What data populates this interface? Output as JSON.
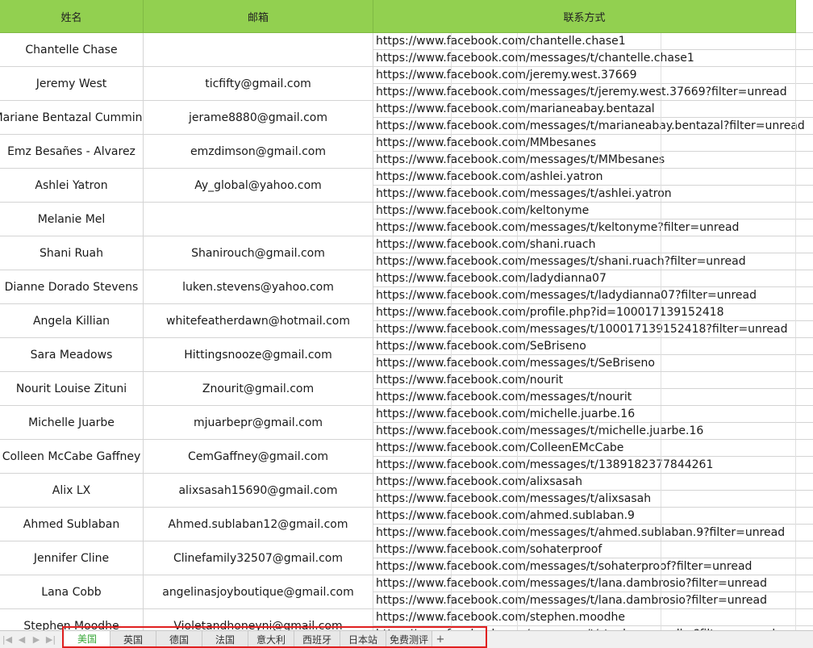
{
  "headers": {
    "name": "姓名",
    "email": "邮箱",
    "contact": "联系方式"
  },
  "rows": [
    {
      "name": "Chantelle Chase",
      "email": "",
      "link1": "https://www.facebook.com/chantelle.chase1",
      "link2": "https://www.facebook.com/messages/t/chantelle.chase1"
    },
    {
      "name": "Jeremy West",
      "email": "ticfifty@gmail.com",
      "link1": "https://www.facebook.com/jeremy.west.37669",
      "link2": "https://www.facebook.com/messages/t/jeremy.west.37669?filter=unread"
    },
    {
      "name": "Mariane Bentazal Cumming",
      "email": "jerame8880@gmail.com",
      "link1": "https://www.facebook.com/marianeabay.bentazal",
      "link2": "https://www.facebook.com/messages/t/marianeabay.bentazal?filter=unread"
    },
    {
      "name": "Emz Besañes - Alvarez",
      "email": "emzdimson@gmail.com",
      "link1": "https://www.facebook.com/MMbesanes",
      "link2": "https://www.facebook.com/messages/t/MMbesanes"
    },
    {
      "name": "Ashlei Yatron",
      "email": "Ay_global@yahoo.com",
      "link1": "https://www.facebook.com/ashlei.yatron",
      "link2": "https://www.facebook.com/messages/t/ashlei.yatron"
    },
    {
      "name": "Melanie Mel",
      "email": "",
      "link1": "https://www.facebook.com/keltonyme",
      "link2": "https://www.facebook.com/messages/t/keltonyme?filter=unread"
    },
    {
      "name": "Shani Ruah",
      "email": "Shanirouch@gmail.com",
      "link1": "https://www.facebook.com/shani.ruach",
      "link2": "https://www.facebook.com/messages/t/shani.ruach?filter=unread"
    },
    {
      "name": "Dianne Dorado Stevens",
      "email": "luken.stevens@yahoo.com",
      "link1": "https://www.facebook.com/ladydianna07",
      "link2": "https://www.facebook.com/messages/t/ladydianna07?filter=unread"
    },
    {
      "name": "Angela Killian",
      "email": "whitefeatherdawn@hotmail.com",
      "link1": "https://www.facebook.com/profile.php?id=100017139152418",
      "link2": "https://www.facebook.com/messages/t/100017139152418?filter=unread"
    },
    {
      "name": "Sara Meadows",
      "email": "Hittingsnooze@gmail.com",
      "link1": "https://www.facebook.com/SeBriseno",
      "link2": "https://www.facebook.com/messages/t/SeBriseno"
    },
    {
      "name": "Nourit Louise Zituni",
      "email": "Znourit@gmail.com",
      "link1": "https://www.facebook.com/nourit",
      "link2": "https://www.facebook.com/messages/t/nourit"
    },
    {
      "name": "Michelle Juarbe",
      "email": "mjuarbepr@gmail.com",
      "link1": "https://www.facebook.com/michelle.juarbe.16",
      "link2": "https://www.facebook.com/messages/t/michelle.juarbe.16"
    },
    {
      "name": "Colleen McCabe Gaffney",
      "email": "CemGaffney@gmail.com",
      "link1": "https://www.facebook.com/ColleenEMcCabe",
      "link2": "https://www.facebook.com/messages/t/1389182377844261"
    },
    {
      "name": "Alix LX",
      "email": "alixsasah15690@gmail.com",
      "link1": "https://www.facebook.com/alixsasah",
      "link2": "https://www.facebook.com/messages/t/alixsasah"
    },
    {
      "name": "Ahmed Sublaban",
      "email": "Ahmed.sublaban12@gmail.com",
      "link1": "https://www.facebook.com/ahmed.sublaban.9",
      "link2": "https://www.facebook.com/messages/t/ahmed.sublaban.9?filter=unread"
    },
    {
      "name": "Jennifer Cline",
      "email": "Clinefamily32507@gmail.com",
      "link1": "https://www.facebook.com/sohaterproof",
      "link2": "https://www.facebook.com/messages/t/sohaterproof?filter=unread"
    },
    {
      "name": "Lana Cobb",
      "email": "angelinasjoyboutique@gmail.com",
      "link1": "https://www.facebook.com/messages/t/lana.dambrosio?filter=unread",
      "link2": "https://www.facebook.com/messages/t/lana.dambrosio?filter=unread"
    },
    {
      "name": "Stephen Moodhe",
      "email": "Violetandhoneyni@gmail.com",
      "link1": "https://www.facebook.com/stephen.moodhe",
      "link2": "https://www.facebook.com/messages/t/stephen.moodhe?filter=unread"
    }
  ],
  "tabs": [
    "美国",
    "英国",
    "德国",
    "法国",
    "意大利",
    "西班牙",
    "日本站",
    "免费测评"
  ],
  "active_tab": "美国",
  "add_tab_label": "+",
  "nav": {
    "first": "|◀",
    "prev": "◀",
    "next": "▶",
    "last": "▶|"
  },
  "colors": {
    "header_bg": "#92d050",
    "active_tab_text": "#3aa83a",
    "highlight_border": "#e02020"
  }
}
